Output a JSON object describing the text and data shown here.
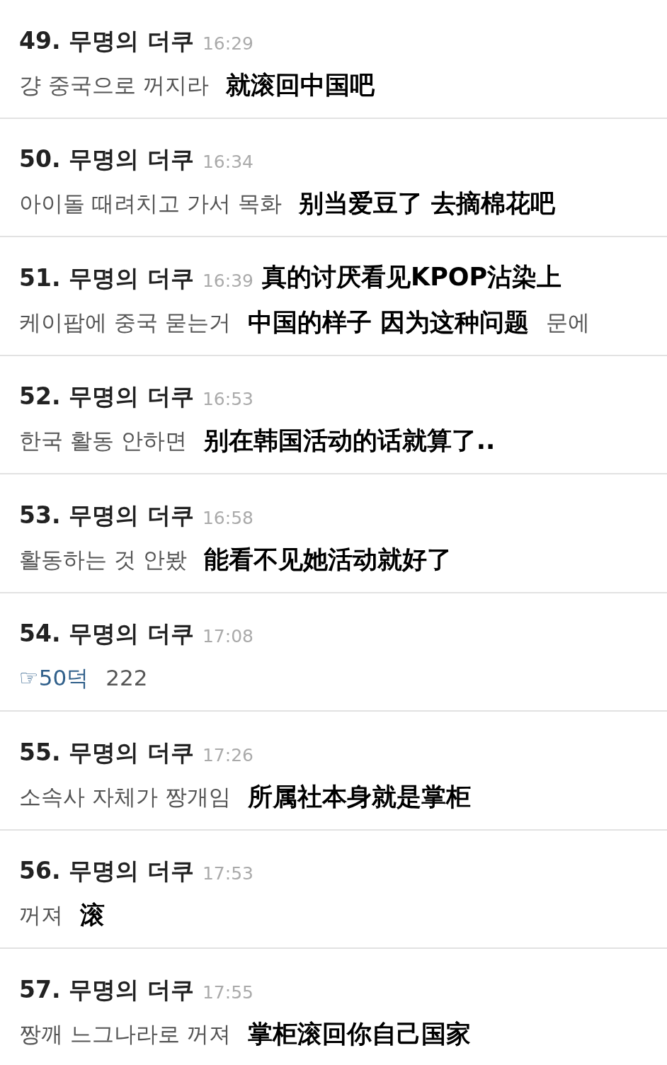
{
  "comments": [
    {
      "number": "49.",
      "author": "무명의 더쿠",
      "time": "16:29",
      "body": [
        {
          "kind": "korean",
          "text": "걍 중국으로 꺼지라"
        },
        {
          "kind": "chinese",
          "text": "就滚回中国吧"
        }
      ]
    },
    {
      "number": "50.",
      "author": "무명의 더쿠",
      "time": "16:34",
      "body": [
        {
          "kind": "korean",
          "text": "아이돌 때려치고 가서 목화"
        },
        {
          "kind": "chinese",
          "text": "别当爱豆了 去摘棉花吧"
        }
      ]
    },
    {
      "number": "51.",
      "author": "무명의 더쿠",
      "time": "16:39",
      "header_translation": "真的讨厌看见KPOP沾染上",
      "body": [
        {
          "kind": "korean",
          "text": "케이팝에 중국 묻는거"
        },
        {
          "kind": "chinese",
          "text": "中国的样子 因为这种问题"
        },
        {
          "kind": "korean",
          "text": "문에"
        }
      ]
    },
    {
      "number": "52.",
      "author": "무명의 더쿠",
      "time": "16:53",
      "body": [
        {
          "kind": "korean",
          "text": "한국 활동 안하면"
        },
        {
          "kind": "chinese",
          "text": "别在韩国活动的话就算了.."
        }
      ]
    },
    {
      "number": "53.",
      "author": "무명의 더쿠",
      "time": "16:58",
      "body": [
        {
          "kind": "korean",
          "text": "활동하는 것 안봤"
        },
        {
          "kind": "chinese",
          "text": "能看不见她活动就好了"
        }
      ]
    },
    {
      "number": "54.",
      "author": "무명의 더쿠",
      "time": "17:08",
      "body": [
        {
          "kind": "link",
          "text": "☞50덕"
        },
        {
          "kind": "korean",
          "text": "222"
        }
      ]
    },
    {
      "number": "55.",
      "author": "무명의 더쿠",
      "time": "17:26",
      "body": [
        {
          "kind": "korean",
          "text": "소속사 자체가 짱개임"
        },
        {
          "kind": "chinese",
          "text": "所属社本身就是掌柜"
        }
      ]
    },
    {
      "number": "56.",
      "author": "무명의 더쿠",
      "time": "17:53",
      "body": [
        {
          "kind": "korean",
          "text": "꺼져"
        },
        {
          "kind": "chinese",
          "text": "滚"
        }
      ]
    },
    {
      "number": "57.",
      "author": "무명의 더쿠",
      "time": "17:55",
      "body": [
        {
          "kind": "korean",
          "text": "짱깨 느그나라로 꺼져"
        },
        {
          "kind": "chinese",
          "text": "掌柜滚回你自己国家"
        }
      ]
    }
  ]
}
